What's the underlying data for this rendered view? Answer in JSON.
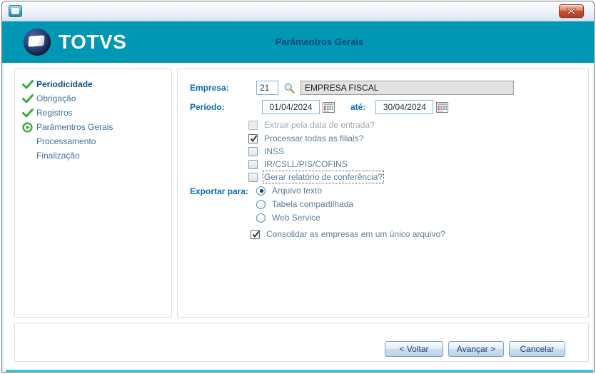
{
  "header": {
    "brand": "TOTVS",
    "title": "Parâmentros Gerais"
  },
  "sidebar": {
    "items": [
      {
        "label": "Periodicidade",
        "state": "done-active"
      },
      {
        "label": "Obrigação",
        "state": "done"
      },
      {
        "label": "Registros",
        "state": "done"
      },
      {
        "label": "Parâmentros Gerais",
        "state": "current"
      },
      {
        "label": "Processamento",
        "state": "pending"
      },
      {
        "label": "Finalização",
        "state": "pending"
      }
    ]
  },
  "form": {
    "empresa_label": "Empresa:",
    "empresa_code": "21",
    "empresa_name": "EMPRESA FISCAL",
    "periodo_label": "Período:",
    "periodo_de": "01/04/2024",
    "ate_label": "até:",
    "periodo_ate": "30/04/2024",
    "checkboxes": [
      {
        "label": "Extrair pela data de entrada?",
        "checked": false,
        "disabled": true
      },
      {
        "label": "Processar todas as filiais?",
        "checked": true,
        "disabled": false
      },
      {
        "label": "INSS",
        "checked": false,
        "disabled": false
      },
      {
        "label": "IR/CSLL/PIS/COFINS",
        "checked": false,
        "disabled": false
      },
      {
        "label": "Gerar relatório de conferência?",
        "checked": false,
        "disabled": false,
        "focused": true
      }
    ],
    "exportar_label": "Exportar para:",
    "export_options": [
      {
        "label": "Arquivo texto",
        "selected": true
      },
      {
        "label": "Tabela compartilhada",
        "selected": false
      },
      {
        "label": "Web Service",
        "selected": false
      }
    ],
    "consolidar": {
      "label": "Consolidar as empresas em um único arquivo?",
      "checked": true
    }
  },
  "buttons": {
    "voltar": "< Voltar",
    "avancar": "Avançar >",
    "cancelar": "Cancelar"
  },
  "colors": {
    "header_teal": "#0097b4",
    "title_navy": "#0d4a78",
    "label_blue": "#0a6db6",
    "sidebar_blue": "#41729e",
    "accent_green": "#3fa93f",
    "bottom_cyan": "#2cc6e4"
  }
}
